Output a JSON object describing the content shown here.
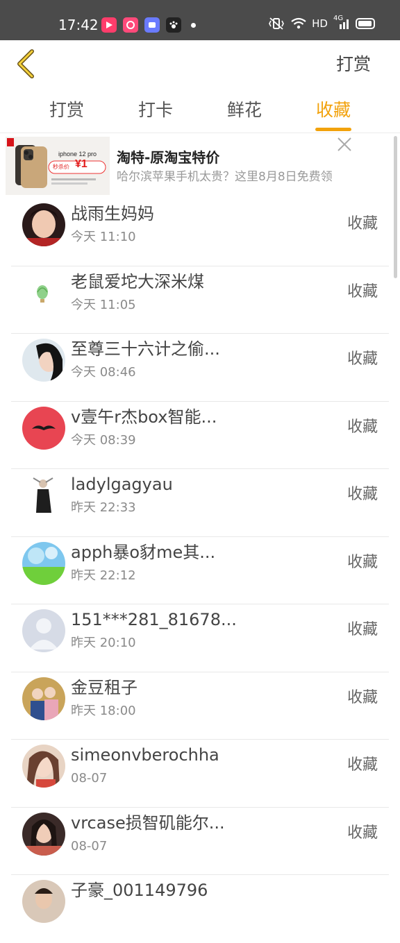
{
  "status_bar": {
    "time": "17:42",
    "network": "HD",
    "signal": "4G"
  },
  "header": {
    "action": "打赏"
  },
  "tabs": [
    {
      "label": "打赏",
      "active": false
    },
    {
      "label": "打卡",
      "active": false
    },
    {
      "label": "鲜花",
      "active": false
    },
    {
      "label": "收藏",
      "active": true
    }
  ],
  "ad": {
    "title": "淘特-原淘宝特价",
    "description": "哈尔滨苹果手机太贵？这里8月8日免费领",
    "image_text": "iphone 12 pro",
    "price_text": "¥1",
    "price_label": "秒杀价"
  },
  "list": [
    {
      "name": "战雨生妈妈",
      "time": "今天 11:10",
      "action": "收藏"
    },
    {
      "name": "老鼠爱坨大深米煤",
      "time": "今天 11:05",
      "action": "收藏"
    },
    {
      "name": "至尊三十六计之偷...",
      "time": "今天 08:46",
      "action": "收藏"
    },
    {
      "name": "v壹午r杰box智能...",
      "time": "今天 08:39",
      "action": "收藏"
    },
    {
      "name": "ladylgagyau",
      "time": "昨天 22:33",
      "action": "收藏"
    },
    {
      "name": "apph暴o豺me其...",
      "time": "昨天 22:12",
      "action": "收藏"
    },
    {
      "name": "151***281_81678...",
      "time": "昨天 20:10",
      "action": "收藏"
    },
    {
      "name": "金豆租子",
      "time": "昨天 18:00",
      "action": "收藏"
    },
    {
      "name": "simeonvberochha",
      "time": "08-07",
      "action": "收藏"
    },
    {
      "name": "vrcase损智矶能尔...",
      "time": "08-07",
      "action": "收藏"
    },
    {
      "name": "子豪_001149796",
      "time": "",
      "action": ""
    }
  ],
  "colors": {
    "accent": "#f2a20c",
    "status_bar": "#4b4b4b"
  }
}
